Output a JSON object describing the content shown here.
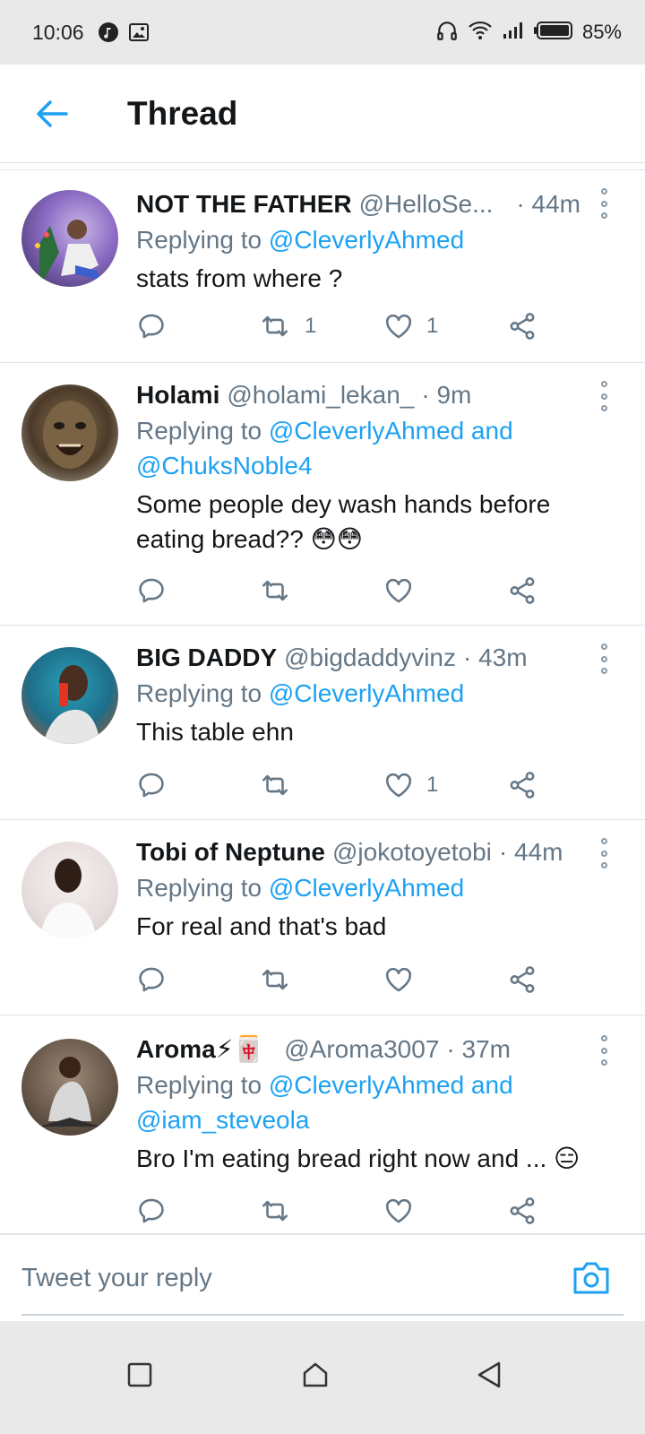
{
  "status_bar": {
    "time": "10:06",
    "battery": "85%",
    "left_icons": [
      "music-icon",
      "image-icon"
    ],
    "right_icons": [
      "headphones-icon",
      "wifi-icon",
      "signal-icon",
      "battery-icon"
    ]
  },
  "header": {
    "title": "Thread",
    "back_icon": "back-arrow-icon"
  },
  "tweets": [
    {
      "display_name": "NOT THE FATHER",
      "handle": "@HelloSe...",
      "time": "· 44m",
      "replying_prefix": "Replying to ",
      "replying_to": "@CleverlyAhmed",
      "replying_line2": "",
      "text": "stats from where ?",
      "retweets": "1",
      "likes": "1"
    },
    {
      "display_name": "Holami",
      "handle": "@holami_lekan_",
      "time": "· 9m",
      "replying_prefix": "Replying to ",
      "replying_to": "@CleverlyAhmed and",
      "replying_line2": "@ChuksNoble4",
      "text": "Some people dey wash hands before eating bread?? 😳😳",
      "retweets": "",
      "likes": ""
    },
    {
      "display_name": "BIG DADDY",
      "handle": "@bigdaddyvinz",
      "time": "· 43m",
      "replying_prefix": "Replying to ",
      "replying_to": "@CleverlyAhmed",
      "replying_line2": "",
      "text": "This table ehn",
      "retweets": "",
      "likes": "1"
    },
    {
      "display_name": "Tobi of Neptune",
      "handle": "@jokotoyetobi",
      "time": "· 44m",
      "replying_prefix": "Replying to ",
      "replying_to": "@CleverlyAhmed",
      "replying_line2": "",
      "text": "For real and that's bad",
      "retweets": "",
      "likes": ""
    },
    {
      "display_name": "Aroma⚡🀄",
      "handle": "@Aroma3007",
      "time": "· 37m",
      "replying_prefix": "Replying to ",
      "replying_to": "@CleverlyAhmed and",
      "replying_line2": "@iam_steveola",
      "text": "Bro I'm eating bread right now and ... 😑",
      "retweets": "",
      "likes": ""
    }
  ],
  "composer": {
    "placeholder": "Tweet your reply",
    "camera_icon": "camera-icon"
  },
  "nav_bar": {
    "buttons": [
      "recents-square-icon",
      "home-icon",
      "back-triangle-icon"
    ]
  },
  "colors": {
    "accent": "#1da1f2",
    "secondary_text": "#657786",
    "divider": "#dfe4e8",
    "system_bar": "#e9e9e9"
  }
}
